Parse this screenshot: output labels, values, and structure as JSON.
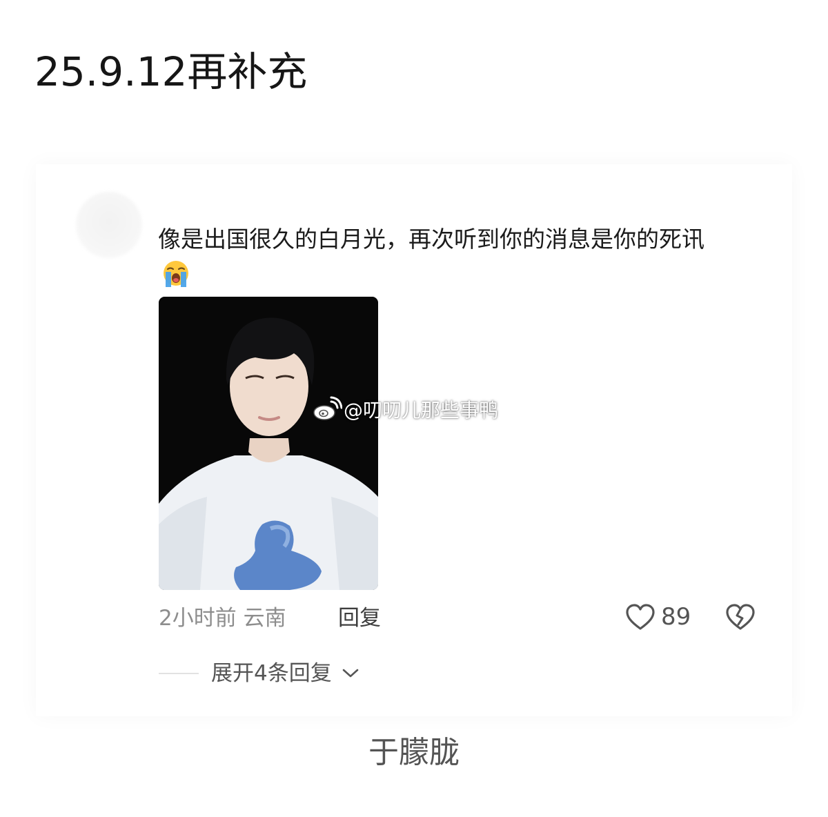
{
  "post": {
    "title": "25.9.12再补充"
  },
  "comment": {
    "text": "像是出国很久的白月光，再次听到你的消息是你的死讯",
    "emoji_icon": "crying-face-icon",
    "photo_icon": "portrait-photo",
    "watermark": "@叨叨儿那些事鸭",
    "watermark_icon": "weibo-logo-icon",
    "time_location": "2小时前 云南",
    "reply_label": "回复",
    "like_icon": "heart-outline-icon",
    "like_count": "89",
    "dislike_icon": "broken-heart-icon",
    "expand_label": "展开4条回复",
    "expand_icon": "chevron-down-icon"
  },
  "caption": "于朦胧",
  "colors": {
    "text_primary": "#1b1b1b",
    "text_secondary": "#8d8d8d",
    "icon_gray": "#555555",
    "photo_background": "#080808",
    "shirt_print_blue": "#5b86c9"
  }
}
